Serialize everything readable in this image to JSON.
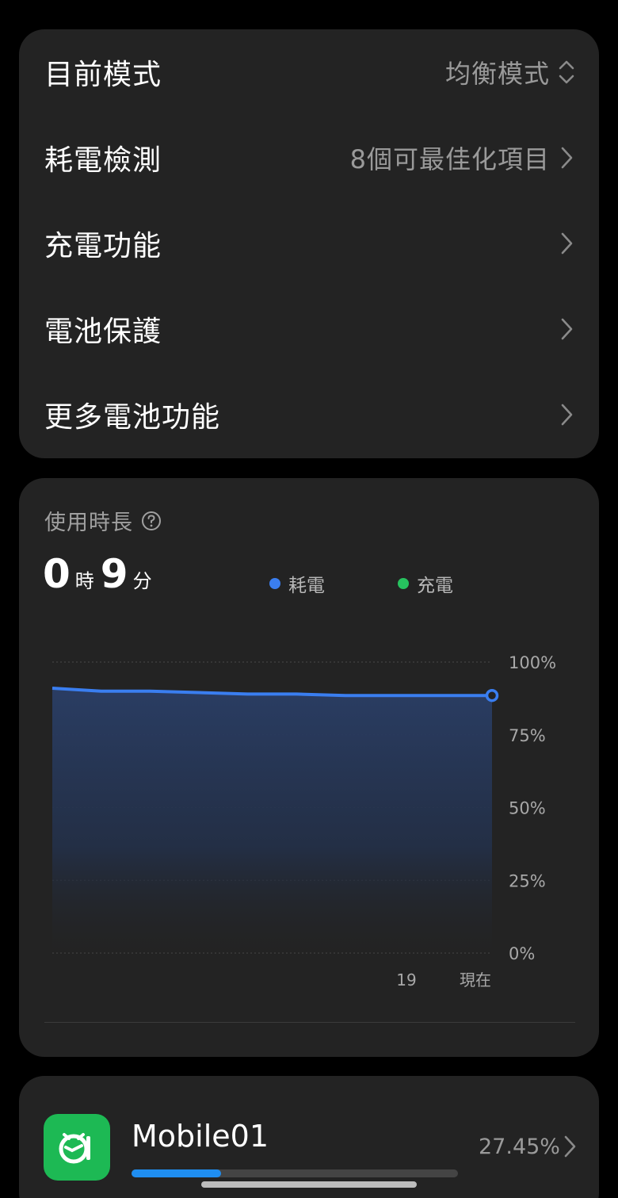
{
  "settings": {
    "rows": [
      {
        "label": "目前模式",
        "value": "均衡模式",
        "icon": "updown-chevron-icon"
      },
      {
        "label": "耗電檢測",
        "value": "8個可最佳化項目",
        "icon": "chevron-right-icon"
      },
      {
        "label": "充電功能",
        "value": "",
        "icon": "chevron-right-icon"
      },
      {
        "label": "電池保護",
        "value": "",
        "icon": "chevron-right-icon"
      },
      {
        "label": "更多電池功能",
        "value": "",
        "icon": "chevron-right-icon"
      }
    ]
  },
  "usage": {
    "title": "使用時長",
    "hours": "0",
    "hours_unit": "時",
    "minutes": "9",
    "minutes_unit": "分",
    "legend_drain": "耗電",
    "legend_charge": "充電"
  },
  "colors": {
    "drain": "#3a7ef0",
    "charge": "#27c25f",
    "background": "#000000",
    "card": "#232323"
  },
  "chart_data": {
    "type": "area",
    "title": "",
    "xlabel": "",
    "ylabel": "",
    "ylim": [
      0,
      100
    ],
    "yticks": [
      "100%",
      "75%",
      "50%",
      "25%",
      "0%"
    ],
    "xticks": [
      "19",
      "現在"
    ],
    "grid": true,
    "series": [
      {
        "name": "耗電",
        "values": [
          91,
          90,
          90,
          89.5,
          89,
          89,
          88.5,
          88.5,
          88.5,
          88.5
        ]
      }
    ]
  },
  "app": {
    "name": "Mobile01",
    "percent": "27.45%",
    "fraction": 0.2745,
    "icon": "mobile01-logo-icon"
  }
}
